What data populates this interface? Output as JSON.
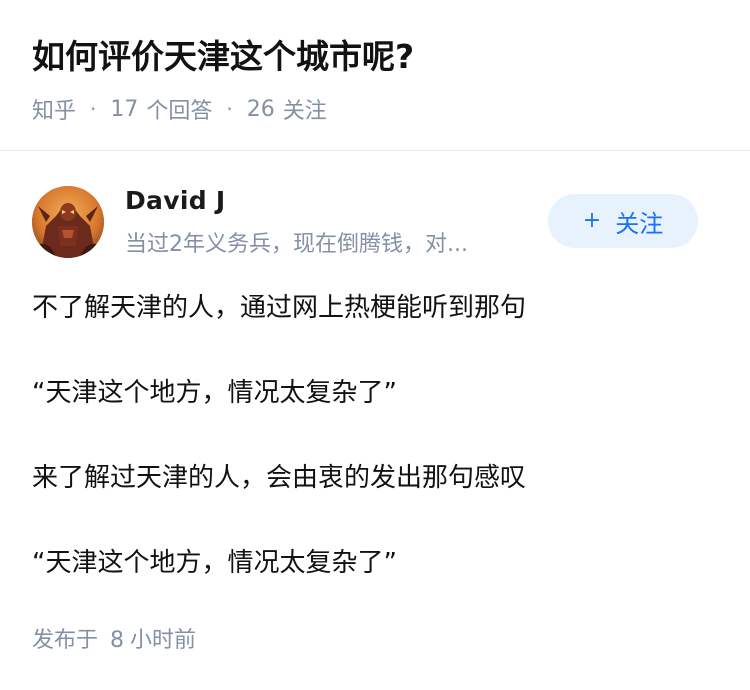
{
  "question": {
    "title": "如何评价天津这个城市呢?",
    "source": "知乎",
    "separator": "·",
    "answers_count": "17",
    "answers_label": "个回答",
    "followers_count": "26",
    "followers_label": "关注"
  },
  "author": {
    "name": "David J",
    "bio": "当过2年义务兵，现在倒腾钱，对...",
    "avatar_icon": "avatar-image"
  },
  "follow_button": {
    "icon": "+",
    "label": "关注",
    "bg_color": "#e8f2fc",
    "text_color": "#1772f6"
  },
  "answer": {
    "paragraphs": [
      "不了解天津的人，通过网上热梗能听到那句",
      "“天津这个地方，情况太复杂了”",
      "来了解过天津的人，会由衷的发出那句感叹",
      "“天津这个地方，情况太复杂了”"
    ]
  },
  "publish": {
    "prefix": "发布于",
    "amount": "8",
    "unit": "小时前"
  }
}
